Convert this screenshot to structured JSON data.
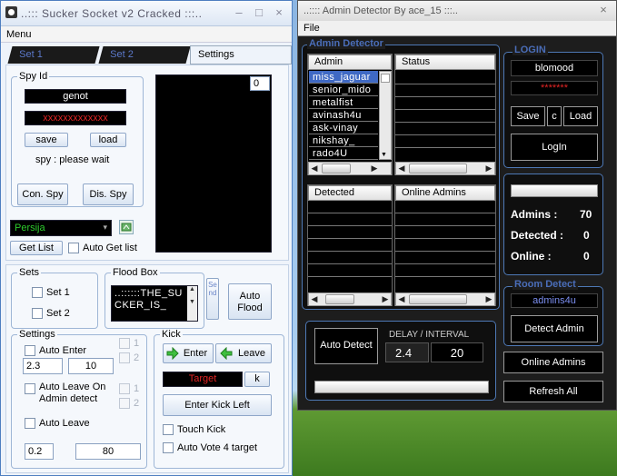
{
  "left_window": {
    "title": "..::: Sucker Socket v2 Cracked :::..",
    "menu": "Menu",
    "tabs": [
      "Set 1",
      "Set 2",
      "Settings"
    ],
    "spy": {
      "group_label": "Spy Id",
      "name_value": "genot",
      "password_value": "xxxxxxxxxxxxx",
      "save_label": "save",
      "load_label": "load",
      "status": "spy : please wait",
      "con_spy_label": "Con. Spy",
      "dis_spy_label": "Dis. Spy",
      "counter": "0"
    },
    "room_select": "Persija",
    "get_list_label": "Get List",
    "auto_get_list_label": "Auto Get list",
    "sets": {
      "group_label": "Sets",
      "set1": "Set 1",
      "set2": "Set 2"
    },
    "flood": {
      "group_label": "Flood Box",
      "text": "..::::::THE_SUCKER_IS_",
      "send_label": "Send",
      "auto_flood_label": "Auto Flood"
    },
    "settings": {
      "group_label": "Settings",
      "auto_enter": "Auto Enter",
      "enter_val1": "2.3",
      "enter_val2": "10",
      "auto_leave_on_admin": "Auto Leave On Admin detect",
      "auto_leave": "Auto Leave",
      "leave_val1": "0.2",
      "leave_val2": "80",
      "opt1": "1",
      "opt2": "2"
    },
    "kick": {
      "group_label": "Kick",
      "enter_label": "Enter",
      "leave_label": "Leave",
      "target_label": "Target",
      "k_label": "k",
      "enter_kick_left": "Enter Kick Left",
      "touch_kick": "Touch Kick",
      "auto_vote": "Auto Vote 4 target"
    }
  },
  "right_window": {
    "title": "..:::: Admin Detector By ace_15 :::..",
    "menu": "File",
    "admin_detector_legend": "Admin Detector",
    "admin_header": "Admin",
    "status_header": "Status",
    "admins": [
      "miss_jaguar",
      "senior_mido",
      "metalfist",
      "avinash4u",
      "ask-vinay",
      "nikshay_",
      "rado4U"
    ],
    "detected_header": "Detected",
    "online_admins_header": "Online Admins",
    "login": {
      "legend": "LOGIN",
      "username": "blomood",
      "password": "*******",
      "save_label": "Save",
      "c_label": "c",
      "load_label": "Load",
      "login_label": "LogIn"
    },
    "stats": {
      "admins_label": "Admins :",
      "admins_value": "70",
      "detected_label": "Detected :",
      "detected_value": "0",
      "online_label": "Online :",
      "online_value": "0"
    },
    "room_detect": {
      "legend": "Room Detect",
      "room": "admins4u",
      "detect_label": "Detect Admin"
    },
    "auto_detect_label": "Auto Detect",
    "delay_label": "DELAY / INTERVAL",
    "delay_value": "2.4",
    "interval_value": "20",
    "online_admins_btn": "Online Admins",
    "refresh_all_btn": "Refresh All"
  }
}
